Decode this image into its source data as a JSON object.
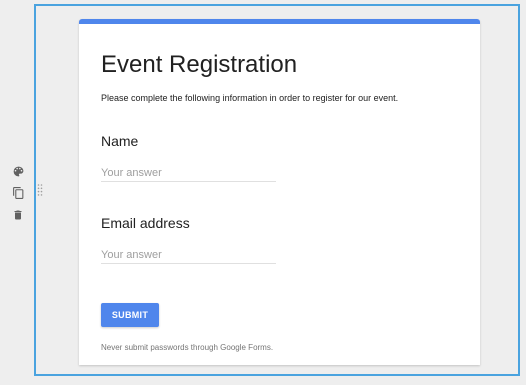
{
  "side_tools": {
    "icons": [
      "palette-icon",
      "copy-icon",
      "trash-icon"
    ]
  },
  "form": {
    "title": "Event Registration",
    "description": "Please complete the following information in order to register for our event.",
    "questions": [
      {
        "label": "Name",
        "placeholder": "Your answer",
        "value": ""
      },
      {
        "label": "Email address",
        "placeholder": "Your answer",
        "value": ""
      }
    ],
    "submit_label": "SUBMIT",
    "footer_note": "Never submit passwords through Google Forms."
  },
  "colors": {
    "accent": "#4f86ec",
    "selection_border": "#4aa3df",
    "background": "#eeeeee",
    "icon": "#616161"
  }
}
